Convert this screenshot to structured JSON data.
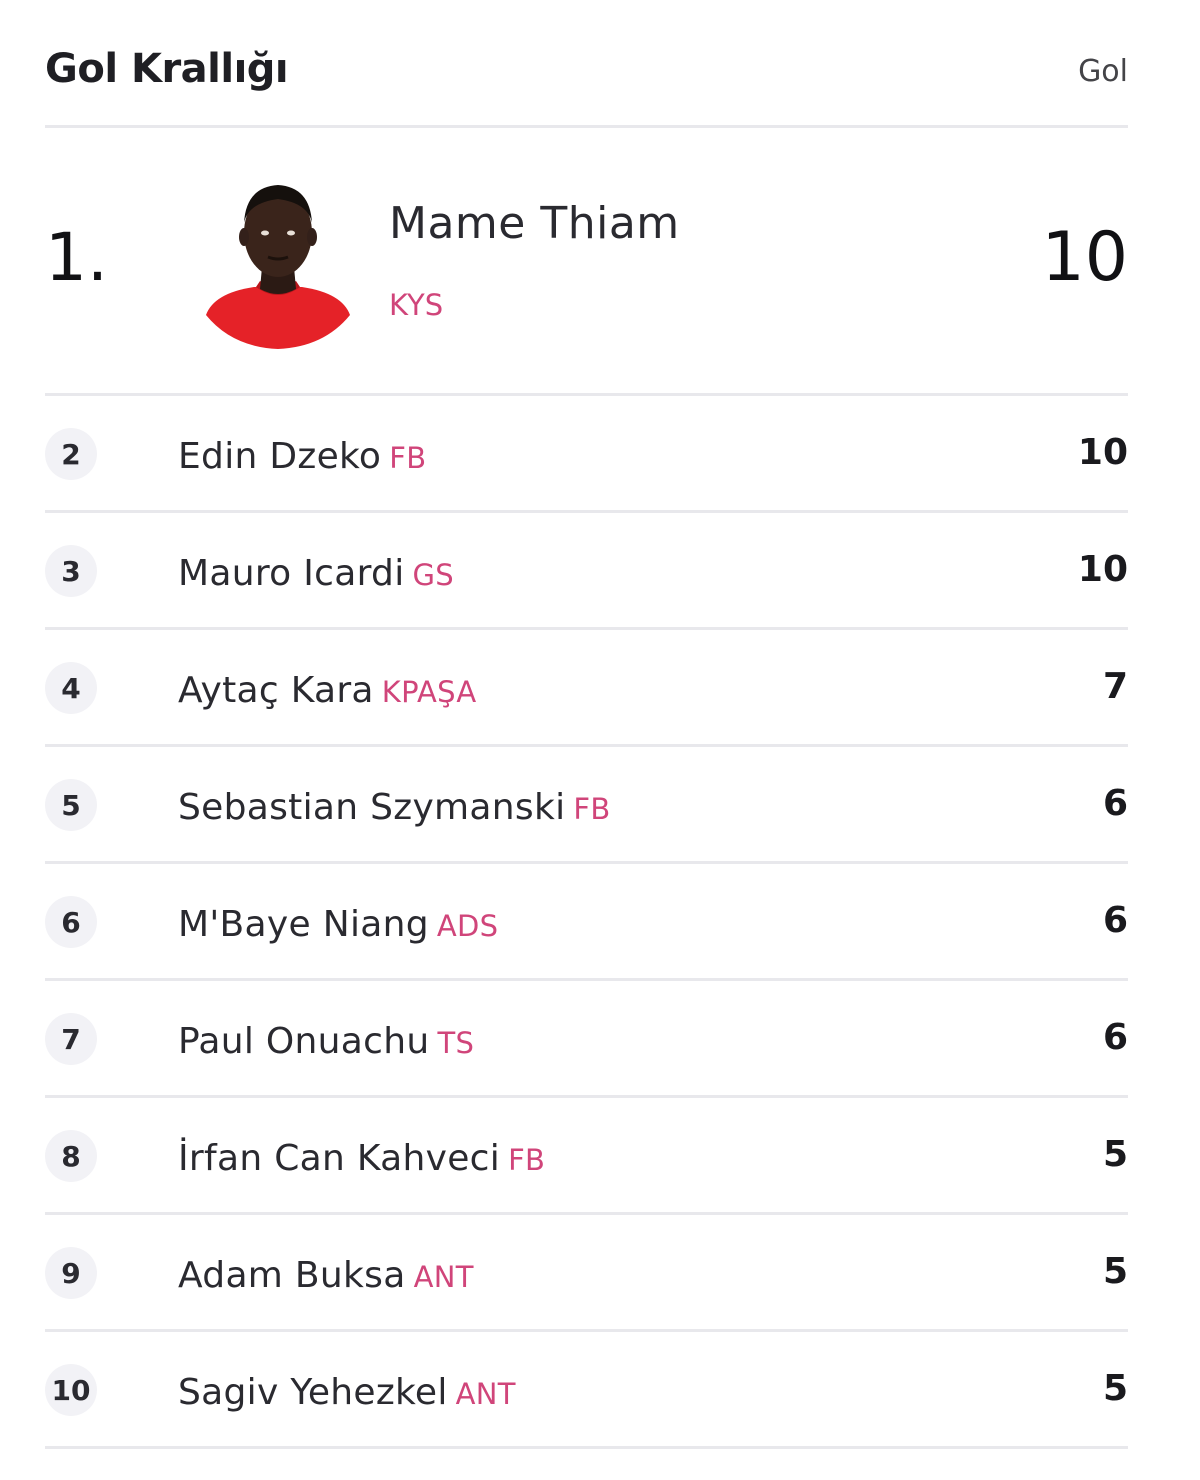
{
  "header": {
    "title": "Gol Krallığı",
    "column_label": "Gol"
  },
  "leader": {
    "rank": "1.",
    "name": "Mame Thiam",
    "team": "KYS",
    "goals": "10"
  },
  "rows": [
    {
      "rank": "2",
      "name": "Edin Dzeko",
      "team": "FB",
      "goals": "10"
    },
    {
      "rank": "3",
      "name": "Mauro Icardi",
      "team": "GS",
      "goals": "10"
    },
    {
      "rank": "4",
      "name": "Aytaç Kara",
      "team": "KPAŞA",
      "goals": "7"
    },
    {
      "rank": "5",
      "name": "Sebastian Szymanski",
      "team": "FB",
      "goals": "6"
    },
    {
      "rank": "6",
      "name": "M'Baye Niang",
      "team": "ADS",
      "goals": "6"
    },
    {
      "rank": "7",
      "name": "Paul Onuachu",
      "team": "TS",
      "goals": "6"
    },
    {
      "rank": "8",
      "name": "İrfan Can Kahveci",
      "team": "FB",
      "goals": "5"
    },
    {
      "rank": "9",
      "name": "Adam Buksa",
      "team": "ANT",
      "goals": "5"
    },
    {
      "rank": "10",
      "name": "Sagiv Yehezkel",
      "team": "ANT",
      "goals": "5"
    }
  ],
  "colors": {
    "team_accent": "#d0457a",
    "jersey": "#e52228",
    "divider": "#e8e8ec"
  }
}
